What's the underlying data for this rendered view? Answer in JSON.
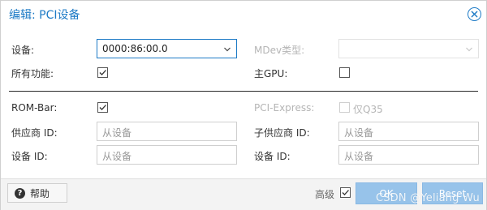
{
  "dialog": {
    "title": "编辑: PCI设备"
  },
  "left": {
    "device_label": "设备:",
    "device_value": "0000:86:00.0",
    "all_functions_label": "所有功能:",
    "all_functions_checked": true,
    "rombar_label": "ROM-Bar:",
    "rombar_checked": true,
    "vendor_id_label": "供应商 ID:",
    "vendor_id_placeholder": "从设备",
    "device_id_label": "设备 ID:",
    "device_id_placeholder": "从设备"
  },
  "right": {
    "mdev_label": "MDev类型:",
    "mdev_value": "",
    "primary_gpu_label": "主GPU:",
    "primary_gpu_checked": false,
    "pcie_label": "PCI-Express:",
    "pcie_option": "仅Q35",
    "subvendor_id_label": "子供应商 ID:",
    "subvendor_id_placeholder": "从设备",
    "subdevice_id_label": "设备 ID:",
    "subdevice_id_placeholder": "从设备"
  },
  "footer": {
    "help_label": "帮助",
    "advanced_label": "高级",
    "advanced_checked": true,
    "ok_label": "OK",
    "reset_label": "Reset"
  },
  "watermark": "CSDN @Yeliang Wu",
  "colors": {
    "accent": "#1e7bc6",
    "button_disabled": "#97c3ea",
    "footer_bg": "#f3f3f3"
  }
}
